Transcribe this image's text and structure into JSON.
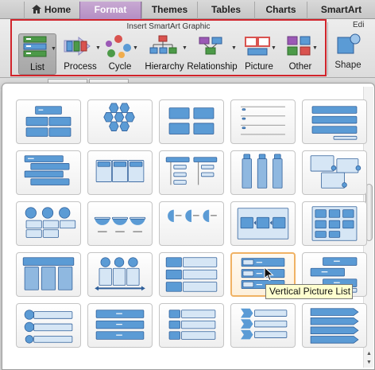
{
  "tabs": [
    {
      "label": "Home",
      "active": false
    },
    {
      "label": "Format",
      "active": true
    },
    {
      "label": "Themes",
      "active": false
    },
    {
      "label": "Tables",
      "active": false
    },
    {
      "label": "Charts",
      "active": false
    },
    {
      "label": "SmartArt",
      "active": false
    }
  ],
  "ribbon": {
    "group_title": "Insert SmartArt Graphic",
    "buttons": [
      {
        "label": "List",
        "icon": "list-icon"
      },
      {
        "label": "Process",
        "icon": "process-icon"
      },
      {
        "label": "Cycle",
        "icon": "cycle-icon"
      },
      {
        "label": "Hierarchy",
        "icon": "hierarchy-icon"
      },
      {
        "label": "Relationship",
        "icon": "relationship-icon"
      },
      {
        "label": "Picture",
        "icon": "picture-icon"
      },
      {
        "label": "Other",
        "icon": "other-icon"
      }
    ],
    "next_group_title": "Edi",
    "shape_label": "Shape"
  },
  "gallery": {
    "tooltip": "Vertical Picture List",
    "hover_index": 18
  },
  "colors": {
    "accent_purple": "#b48ec3",
    "highlight_red": "#d1242b",
    "smartart_blue": "#5b9bd5",
    "hover_orange": "#f0b264",
    "tooltip_bg": "#ffffcf"
  }
}
